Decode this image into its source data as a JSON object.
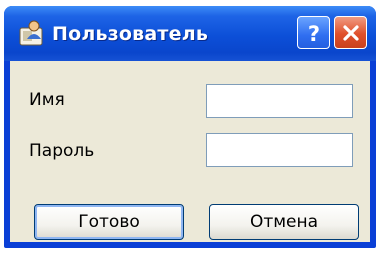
{
  "window": {
    "title": "Пользователь",
    "icons": {
      "app": "user-app-icon",
      "help": "help-icon",
      "close": "close-icon"
    }
  },
  "form": {
    "name_label": "Имя",
    "name_value": "",
    "password_label": "Пароль",
    "password_value": ""
  },
  "buttons": {
    "ok_label": "Готово",
    "cancel_label": "Отмена"
  },
  "colors": {
    "titlebar": "#0c4fd8",
    "client_background": "#ece9d8",
    "close_button": "#e0502b",
    "help_button": "#2f6ef0"
  }
}
